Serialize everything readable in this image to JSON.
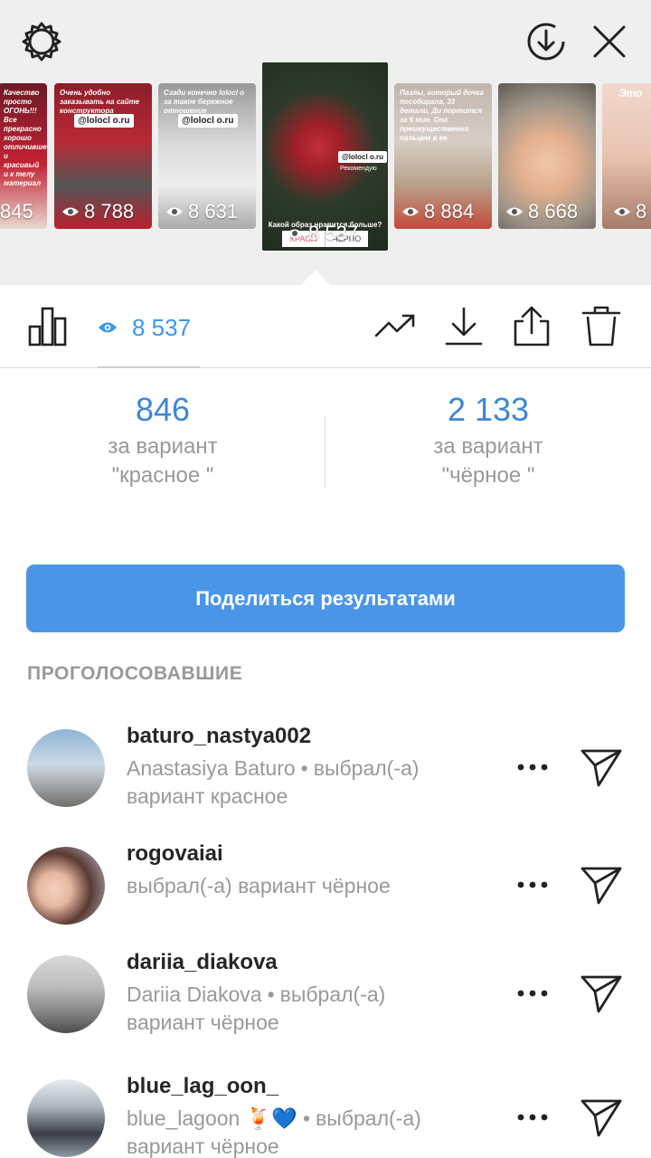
{
  "thumbnails": [
    {
      "views": "845",
      "text": "Качество просто ОГОНЬ!!! Все прекрасно хорошо отличившее, и красивый и к телу материал"
    },
    {
      "views": "8 788",
      "text": "Очень удобно заказывать на сайте конструктора",
      "handle": "@lolocl o.ru"
    },
    {
      "views": "8 631",
      "text": "Сзади конечно lolocl o за такое бережное отношение",
      "handle": "@lolocl o.ru"
    },
    {
      "views": "8 884",
      "text": "Пазлы, который дочка пособирала, 33 детали, Ди портится за 6 мин. Она преимущественно пальцем в ее"
    },
    {
      "views": "8 668",
      "text": ""
    },
    {
      "views": "8",
      "text": "Это"
    }
  ],
  "selected_story": {
    "views": "8 537",
    "handle": "@lolocl o.ru",
    "tag": "Рекомендую",
    "question": "Какой образ нравится больше?",
    "option_a": "КРАСН",
    "option_b": "ЧЁРНО"
  },
  "toolbar": {
    "views": "8 537"
  },
  "results": [
    {
      "count": "846",
      "label": "за вариант",
      "option": "\"красное \""
    },
    {
      "count": "2 133",
      "label": "за вариант",
      "option": "\"чёрное \""
    }
  ],
  "share_button": "Поделиться результатами",
  "section_title": "ПРОГОЛОСОВАВШИЕ",
  "voters": [
    {
      "username": "baturo_nastya002",
      "line1_name": "Anastasiya Baturo",
      "line1_tail": "выбрал(-а)",
      "line2": "вариант красное"
    },
    {
      "username": "rogovaiai",
      "line1_name": "",
      "line1_tail": "выбрал(-а) вариант чёрное",
      "line2": ""
    },
    {
      "username": "dariia_diakova",
      "line1_name": "Dariia Diakova",
      "line1_tail": "выбрал(-а)",
      "line2": "вариант чёрное"
    },
    {
      "username": "blue_lag_oon_",
      "line1_name": "blue_lagoon 🍹💙",
      "line1_tail": "выбрал(-а)",
      "line2": "вариант чёрное"
    }
  ],
  "colors": {
    "accent": "#3897f0",
    "button": "#4a95e8",
    "muted": "#999999",
    "top_background": "#efefef"
  }
}
